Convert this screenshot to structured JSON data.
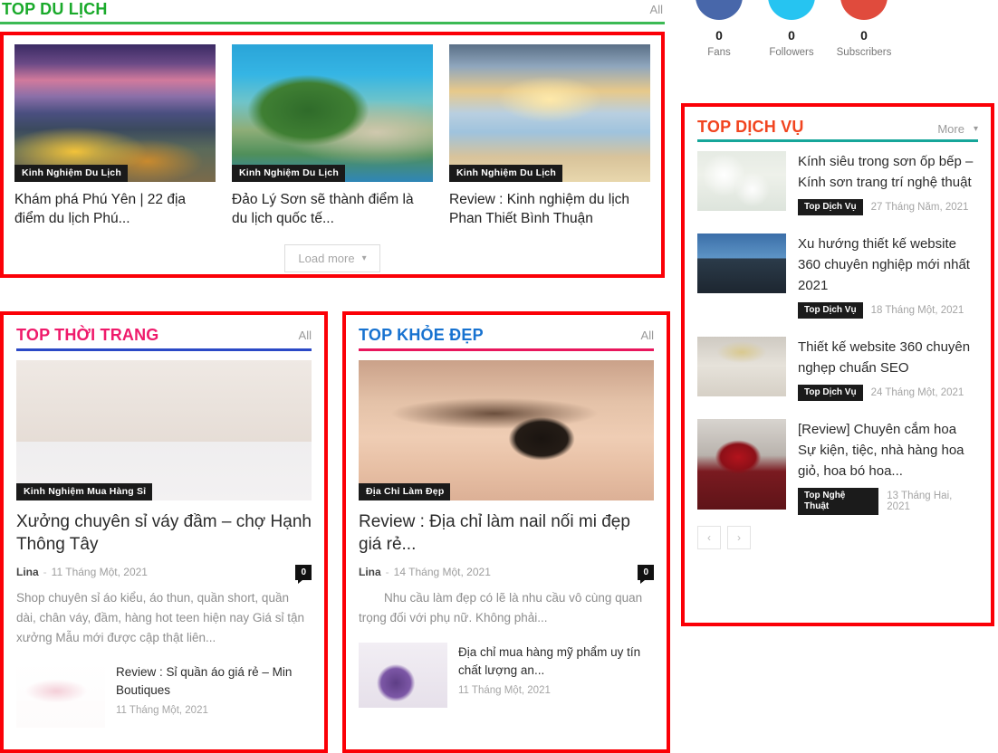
{
  "travel": {
    "title": "TOP DU LỊCH",
    "all_label": "All",
    "accent": "#1aaa2b",
    "cards": [
      {
        "category": "Kinh Nghiệm Du Lịch",
        "title": "Khám phá Phú Yên | 22 địa điểm du lịch Phú..."
      },
      {
        "category": "Kinh Nghiệm Du Lịch",
        "title": "Đảo Lý Sơn sẽ thành điểm là du lịch quốc tế..."
      },
      {
        "category": "Kinh Nghiệm Du Lịch",
        "title": "Review : Kinh nghiệm du lịch Phan Thiết Bình Thuận"
      }
    ],
    "load_more": "Load more",
    "load_more_icon": "chevron-down-icon"
  },
  "fashion": {
    "title": "TOP THỜI TRANG",
    "all_label": "All",
    "title_color": "#ef1a6b",
    "rule_color": "#2b49c6",
    "post": {
      "category": "Kinh Nghiệm Mua Hàng Sỉ",
      "title": "Xưởng chuyên sỉ váy đầm – chợ Hạnh Thông Tây",
      "author": "Lina",
      "separator": "-",
      "date": "11 Tháng Một, 2021",
      "comments": "0",
      "excerpt": "Shop chuyên sỉ áo kiểu, áo thun, quần short, quần dài, chân váy, đầm, hàng hot teen hiện nay Giá sỉ tận xưởng Mẫu mới được cập thật liên..."
    },
    "mini": {
      "title": "Review : Sỉ quần áo giá rẻ – Min Boutiques",
      "date": "11 Tháng Một, 2021"
    }
  },
  "beauty": {
    "title": "TOP KHỎE ĐẸP",
    "all_label": "All",
    "title_color": "#1772d0",
    "rule_color": "#e8175d",
    "post": {
      "category": "Địa Chỉ Làm Đẹp",
      "title": "Review : Địa chỉ làm nail nối mi đẹp giá rẻ...",
      "author": "Lina",
      "separator": "-",
      "date": "14 Tháng Một, 2021",
      "comments": "0",
      "excerpt": "Nhu cầu làm đẹp có lẽ là nhu cầu vô cùng quan trọng đối với phụ nữ. Không phải..."
    },
    "mini": {
      "title": "Địa chỉ mua hàng mỹ phẩm uy tín chất lượng an...",
      "date": "11 Tháng Một, 2021"
    }
  },
  "social": {
    "items": [
      {
        "network": "facebook",
        "count": "0",
        "label": "Fans",
        "color": "#4867aa"
      },
      {
        "network": "twitter",
        "count": "0",
        "label": "Followers",
        "color": "#26c4f1"
      },
      {
        "network": "youtube",
        "count": "0",
        "label": "Subscribers",
        "color": "#e04b3d"
      }
    ]
  },
  "services": {
    "title": "TOP DỊCH VỤ",
    "more_label": "More",
    "more_icon": "chevron-down-icon",
    "title_color": "#f1441f",
    "rule_color": "#16a69a",
    "items": [
      {
        "title": "Kính siêu trong sơn ốp bếp – Kính sơn trang trí nghệ thuật",
        "tag": "Top Dịch Vụ",
        "date": "27 Tháng Năm, 2021"
      },
      {
        "title": "Xu hướng thiết kế website 360 chuyên nghiệp mới nhất 2021",
        "tag": "Top Dịch Vụ",
        "date": "18 Tháng Một, 2021"
      },
      {
        "title": "Thiết kế website 360 chuyên nghẹp chuẩn SEO",
        "tag": "Top Dịch Vụ",
        "date": "24 Tháng Một, 2021"
      },
      {
        "title": "[Review] Chuyên cắm hoa Sự kiện, tiệc, nhà hàng hoa giỏ, hoa bó hoa...",
        "tag": "Top Nghệ Thuật",
        "date": "13 Tháng Hai, 2021"
      }
    ],
    "pager": {
      "prev": "‹",
      "next": "›"
    }
  }
}
